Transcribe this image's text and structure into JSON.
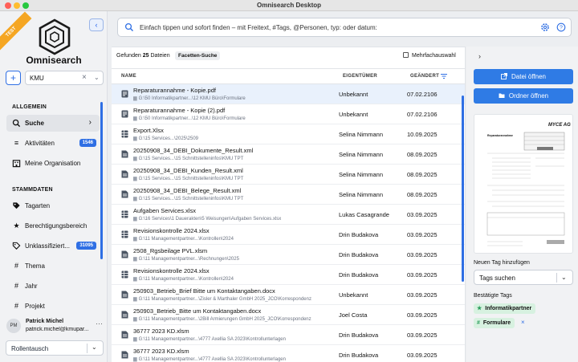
{
  "window": {
    "title": "Omnisearch Desktop"
  },
  "sidebar": {
    "ribbon": "TEST",
    "brand": "Omnisearch",
    "scope_value": "KMU",
    "section_general": "ALLGEMEIN",
    "section_master": "STAMMDATEN",
    "items": [
      {
        "label": "Suche",
        "icon": "search-icon",
        "active": true
      },
      {
        "label": "Aktivitäten",
        "icon": "activity-icon",
        "badge": "1546"
      },
      {
        "label": "Meine Organisation",
        "icon": "organization-icon"
      },
      {
        "label": "Tagarten",
        "icon": "tag-icon"
      },
      {
        "label": "Berechtigungsbereich",
        "icon": "star-icon"
      },
      {
        "label": "Unklassifiziert...",
        "icon": "tag-outline-icon",
        "badge": "31095"
      },
      {
        "label": "Thema",
        "icon": "hash-icon"
      },
      {
        "label": "Jahr",
        "icon": "hash-icon"
      },
      {
        "label": "Projekt",
        "icon": "hash-icon"
      }
    ],
    "user": {
      "initials": "PM",
      "name": "Patrick Michel",
      "email": "patrick.michel@kmupar..."
    },
    "role_button": "Rollentausch"
  },
  "search": {
    "placeholder": "Einfach tippen und sofort finden – mit Freitext, #Tags, @Personen, typ: oder datum:"
  },
  "results": {
    "prefix": "Gefunden",
    "count": "25",
    "suffix": "Dateien",
    "facet_button": "Facetten-Suche",
    "multi_select": "Mehrfachauswahl",
    "columns": {
      "name": "NAME",
      "owner": "EIGENTÜMER",
      "date": "GEÄNDERT"
    },
    "rows": [
      {
        "name": "Reparaturannahme - Kopie.pdf",
        "path": "G:\\50 Informatikpartner...\\12 KMU Büro\\Formulare",
        "owner": "Unbekannt",
        "date": "07.02.2106",
        "type": "pdf",
        "selected": true
      },
      {
        "name": "Reparaturannahme - Kopie (2).pdf",
        "path": "G:\\50 Informatikpartner...\\12 KMU Büro\\Formulare",
        "owner": "Unbekannt",
        "date": "07.02.2106",
        "type": "pdf"
      },
      {
        "name": "Export.Xlsx",
        "path": "G:\\15 Services...\\2025\\2509",
        "owner": "Selina Nimmann",
        "date": "10.09.2025",
        "type": "xlsx"
      },
      {
        "name": "20250908_34_DEBI_Dokumente_Result.xml",
        "path": "G:\\15 Services...\\15 Schnittstelleninfos\\KMU TPT",
        "owner": "Selina Nimmann",
        "date": "08.09.2025",
        "type": "doc"
      },
      {
        "name": "20250908_34_DEBI_Kunden_Result.xml",
        "path": "G:\\15 Services...\\15 Schnittstelleninfos\\KMU TPT",
        "owner": "Selina Nimmann",
        "date": "08.09.2025",
        "type": "doc"
      },
      {
        "name": "20250908_34_DEBI_Belege_Result.xml",
        "path": "G:\\15 Services...\\15 Schnittstelleninfos\\KMU TPT",
        "owner": "Selina Nimmann",
        "date": "08.09.2025",
        "type": "doc"
      },
      {
        "name": "Aufgaben Services.xlsx",
        "path": "G:\\16 Services\\1 Dauerakten\\5 Weisungen\\Aufgaben Services.xlsx",
        "owner": "Lukas Casagrande",
        "date": "03.09.2025",
        "type": "xlsx"
      },
      {
        "name": "Revisionskontrolle 2024.xlsx",
        "path": "G:\\11 Managementpartner...\\Kontrollen\\2024",
        "owner": "Drin Budakova",
        "date": "03.09.2025",
        "type": "xlsx"
      },
      {
        "name": "2508_Rgsbeilage PVL.xlsm",
        "path": "G:\\11 Managementpartner...\\Rechnungen\\2025",
        "owner": "Drin Budakova",
        "date": "03.09.2025",
        "type": "doc"
      },
      {
        "name": "Revisionskontrolle 2024.xlsx",
        "path": "G:\\11 Managementpartner...\\Kontrollen\\2024",
        "owner": "Drin Budakova",
        "date": "03.09.2025",
        "type": "xlsx"
      },
      {
        "name": "250903_Betrieb_Brief Bitte um Kontaktangaben.docx",
        "path": "G:\\11 Managementpartner...\\Zisler & Marthaler GmbH 2025_JCO\\Korrespondenz",
        "owner": "Unbekannt",
        "date": "03.09.2025",
        "type": "doc"
      },
      {
        "name": "250903_Betrieb_Bitte um Kontaktangaben.docx",
        "path": "G:\\11 Managementpartner...\\2Bill Armierungen GmbH 2025_JCO\\Korrespondenz",
        "owner": "Joel Costa",
        "date": "03.09.2025",
        "type": "doc"
      },
      {
        "name": "36777 2023 KD.xlsm",
        "path": "G:\\11 Managementpartner...\\4777 Axellia SA 2023\\Kontrollunterlagen",
        "owner": "Drin Budakova",
        "date": "03.09.2025",
        "type": "doc"
      },
      {
        "name": "36777 2023 KD.xlsm",
        "path": "G:\\11 Managementpartner...\\4777 Axellia SA 2023\\Kontrollunterlagen",
        "owner": "Drin Budakova",
        "date": "03.09.2025",
        "type": "doc"
      }
    ]
  },
  "details": {
    "open_file": "Datei öffnen",
    "open_folder": "Ordner öffnen",
    "preview": {
      "logo_text": "MYCE AG",
      "heading": "Reparaturannahme"
    },
    "new_tag_label": "Neuen Tag hinzufügen",
    "tag_placeholder": "Tags suchen",
    "confirmed_label": "Bestätigte Tags",
    "tags": [
      {
        "label": "Informatikpartner",
        "icon": "star-icon"
      },
      {
        "label": "Formulare",
        "icon": "hash-icon",
        "removable": true
      }
    ],
    "colors": {
      "accent": "#2f7be5",
      "tag_bg": "#d7f1e0",
      "tag_icon": "#2a9d5b"
    }
  }
}
